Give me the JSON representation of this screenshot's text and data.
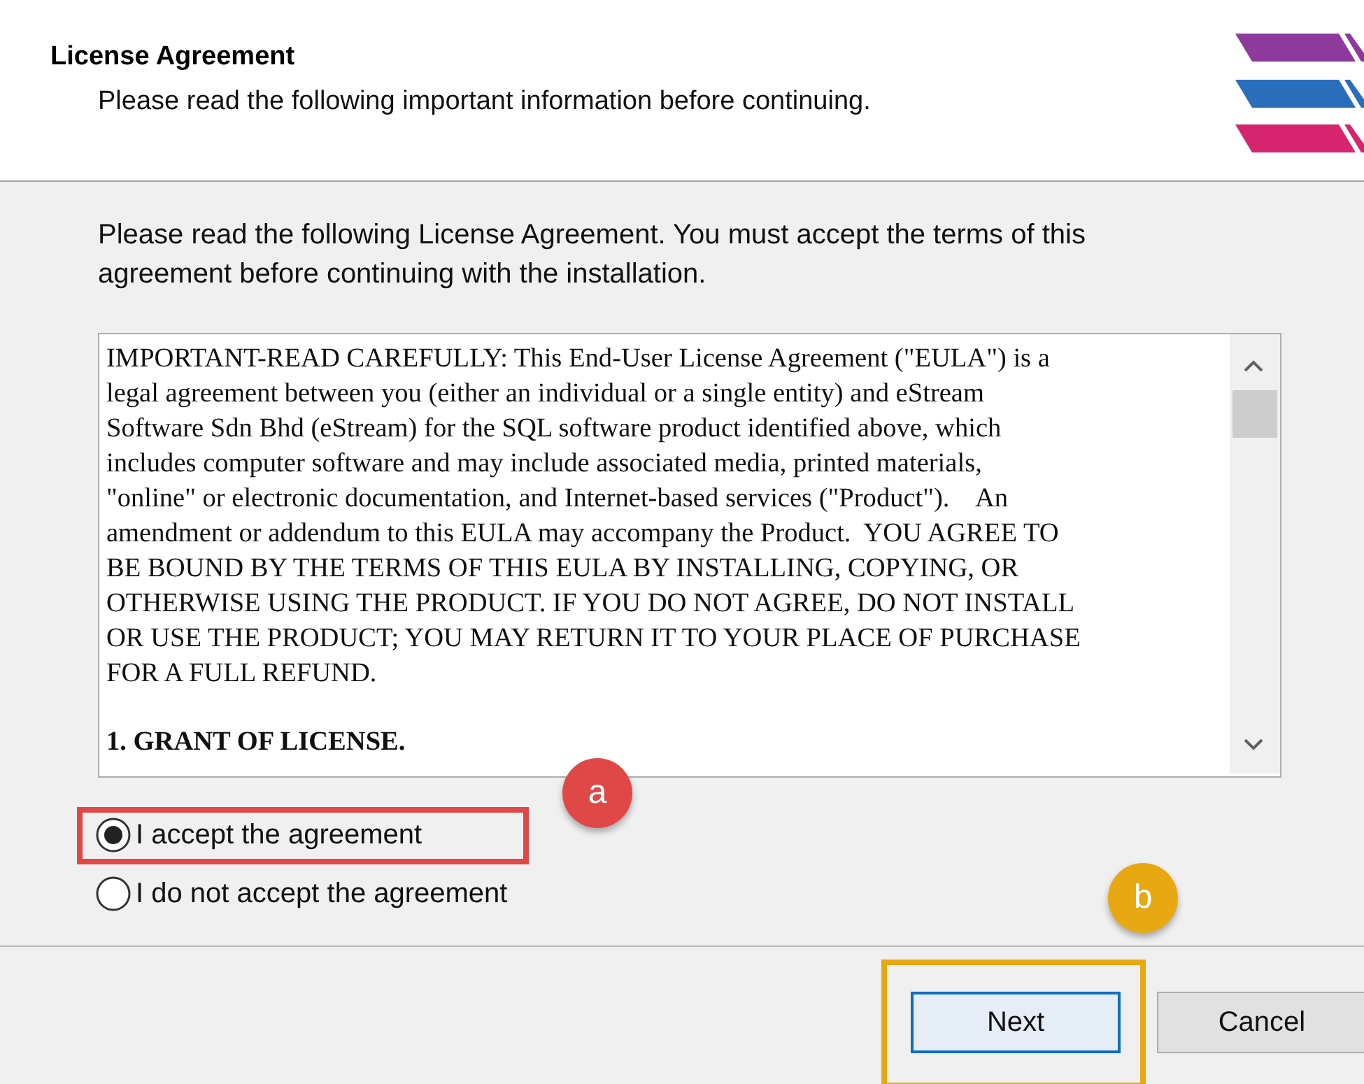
{
  "header": {
    "title": "License Agreement",
    "subtitle": "Please read the following important information before continuing."
  },
  "intro": "Please read the following License Agreement. You must accept the terms of this agreement before continuing with the installation.",
  "license_text": {
    "lines": [
      "IMPORTANT-READ CAREFULLY: This End-User License Agreement (\"EULA\") is a",
      "legal agreement between you (either an individual or a single entity) and eStream",
      "Software Sdn Bhd (eStream) for the SQL software product identified above, which",
      "includes computer software and may include associated media, printed materials,",
      "\"online\" or electronic documentation, and Internet-based services (\"Product\").    An",
      "amendment or addendum to this EULA may accompany the Product.  YOU AGREE TO",
      "BE BOUND BY THE TERMS OF THIS EULA BY INSTALLING, COPYING, OR",
      "OTHERWISE USING THE PRODUCT. IF YOU DO NOT AGREE, DO NOT INSTALL",
      "OR USE THE PRODUCT; YOU MAY RETURN IT TO YOUR PLACE OF PURCHASE",
      "FOR A FULL REFUND."
    ],
    "heading": "1. GRANT OF LICENSE."
  },
  "options": [
    {
      "label": "I accept the agreement",
      "selected": true
    },
    {
      "label": "I do not accept the agreement",
      "selected": false
    }
  ],
  "buttons": [
    {
      "label": "Next",
      "default": true
    },
    {
      "label": "Cancel",
      "default": false
    }
  ],
  "annotations": [
    {
      "label": "a",
      "color": "#e04848"
    },
    {
      "label": "b",
      "color": "#e8a812"
    }
  ]
}
